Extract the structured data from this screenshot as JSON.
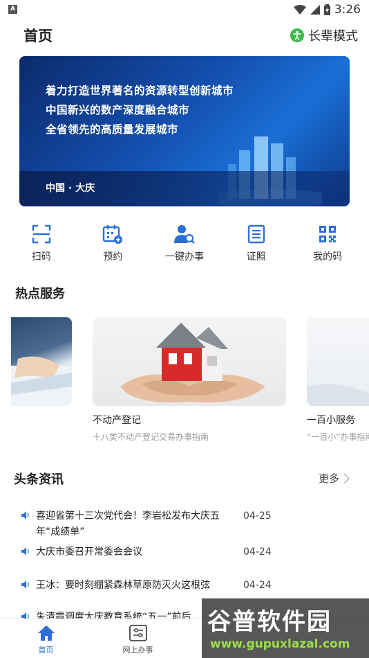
{
  "status_bar": {
    "time": "3:26",
    "left_badge": "A"
  },
  "header": {
    "title": "首页",
    "elder_mode_label": "长辈模式"
  },
  "banner": {
    "lines": [
      "着力打造世界著名的资源转型创新城市",
      "中国新兴的数产深度融合城市",
      "全省领先的高质量发展城市"
    ],
    "footer": "中国 · 大庆"
  },
  "quick_actions": [
    {
      "label": "扫码",
      "icon": "scan-icon"
    },
    {
      "label": "预约",
      "icon": "calendar-add-icon"
    },
    {
      "label": "一键办事",
      "icon": "user-search-icon"
    },
    {
      "label": "证照",
      "icon": "document-icon"
    },
    {
      "label": "我的码",
      "icon": "qrcode-icon"
    }
  ],
  "hot_services": {
    "title": "热点服务",
    "cards": [
      {
        "title": "不动产登记",
        "subtitle": "十八类不动产登记交易办事指南"
      },
      {
        "title": "一百小服务",
        "subtitle": "“一百小”办事指南"
      }
    ]
  },
  "news": {
    "title": "头条资讯",
    "more_label": "更多",
    "items": [
      {
        "text": "喜迎省第十三次党代会！李岩松发布大庆五年“成绩单”",
        "date": "04-25"
      },
      {
        "text": "大庆市委召开常委会会议",
        "date": "04-24"
      },
      {
        "text": "王冰：要时刻绷紧森林草原防灭火这根弦",
        "date": "04-24"
      },
      {
        "text": "朱清霞调度大庆教育系统“五一”前后",
        "date": ""
      }
    ]
  },
  "tabbar": {
    "tabs": [
      {
        "label": "首页",
        "icon": "home-icon",
        "active": true
      },
      {
        "label": "网上办事",
        "icon": "settings-panel-icon",
        "active": false
      }
    ]
  },
  "watermark": {
    "title": "谷普软件园",
    "url": "www.gupuxlazal.com"
  },
  "colors": {
    "accent": "#2d6fd6",
    "elder_green": "#3dbb4a"
  }
}
